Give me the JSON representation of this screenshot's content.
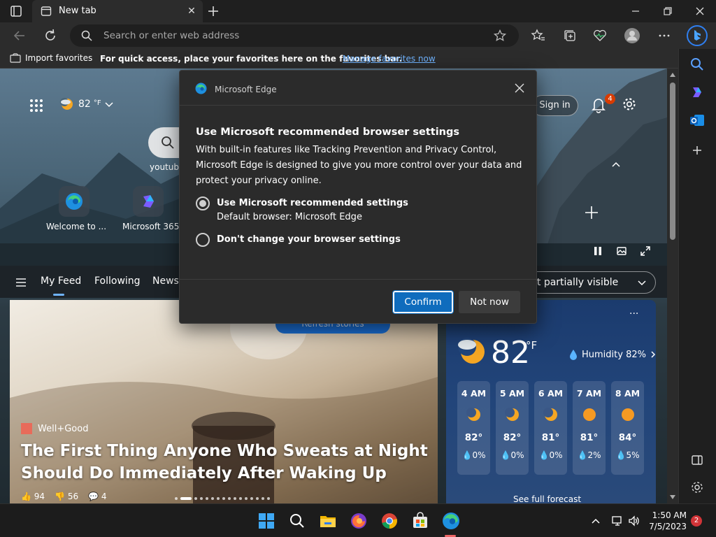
{
  "tab": {
    "title": "New tab"
  },
  "address": {
    "placeholder": "Search or enter web address"
  },
  "favorites_bar": {
    "import_label": "Import favorites",
    "message": "For quick access, place your favorites here on the favorites bar.",
    "manage_link": "Manage favorites now"
  },
  "newtab": {
    "weather_temp": "82",
    "weather_unit": "°F",
    "sign_in": "Sign in",
    "notification_count": "4",
    "search_suggestion": "youtube",
    "tiles": [
      {
        "label": "Welcome to ..."
      },
      {
        "label": "Microsoft 365"
      }
    ],
    "feed_tabs": [
      "My Feed",
      "Following",
      "News"
    ],
    "visibility_dropdown": "nt partially visible",
    "refresh_stories": "Refresh stories"
  },
  "story": {
    "source": "Well+Good",
    "title": "The First Thing Anyone Who Sweats at Night Should Do Immediately After Waking Up",
    "likes": "94",
    "dislikes": "56",
    "comments": "4"
  },
  "weather_card": {
    "more": "···",
    "temp": "82",
    "unit": "°F",
    "humidity": "Humidity 82%",
    "hours": [
      {
        "time": "4 AM",
        "icon": "moon-icon",
        "temp": "82°",
        "precip": "0%"
      },
      {
        "time": "5 AM",
        "icon": "moon-icon",
        "temp": "82°",
        "precip": "0%"
      },
      {
        "time": "6 AM",
        "icon": "moon-icon",
        "temp": "81°",
        "precip": "0%"
      },
      {
        "time": "7 AM",
        "icon": "sun-icon",
        "temp": "81°",
        "precip": "2%"
      },
      {
        "time": "8 AM",
        "icon": "sun-icon",
        "temp": "84°",
        "precip": "5%"
      }
    ],
    "forecast_link": "See full forecast"
  },
  "dialog": {
    "app_name": "Microsoft Edge",
    "title": "Use Microsoft recommended browser settings",
    "description": "With built-in features like Tracking Prevention and Privacy Control, Microsoft Edge is designed to give you more control over your data and protect your privacy online.",
    "option_recommended": "Use Microsoft recommended settings",
    "option_recommended_sub": "Default browser: Microsoft Edge",
    "option_keep": "Don't change your browser settings",
    "confirm": "Confirm",
    "not_now": "Not now"
  },
  "taskbar": {
    "time": "1:50 AM",
    "date": "7/5/2023",
    "notification_count": "2"
  },
  "colors": {
    "accent": "#0f6cbd",
    "link": "#6fb3ff",
    "badge": "#d83b01"
  }
}
